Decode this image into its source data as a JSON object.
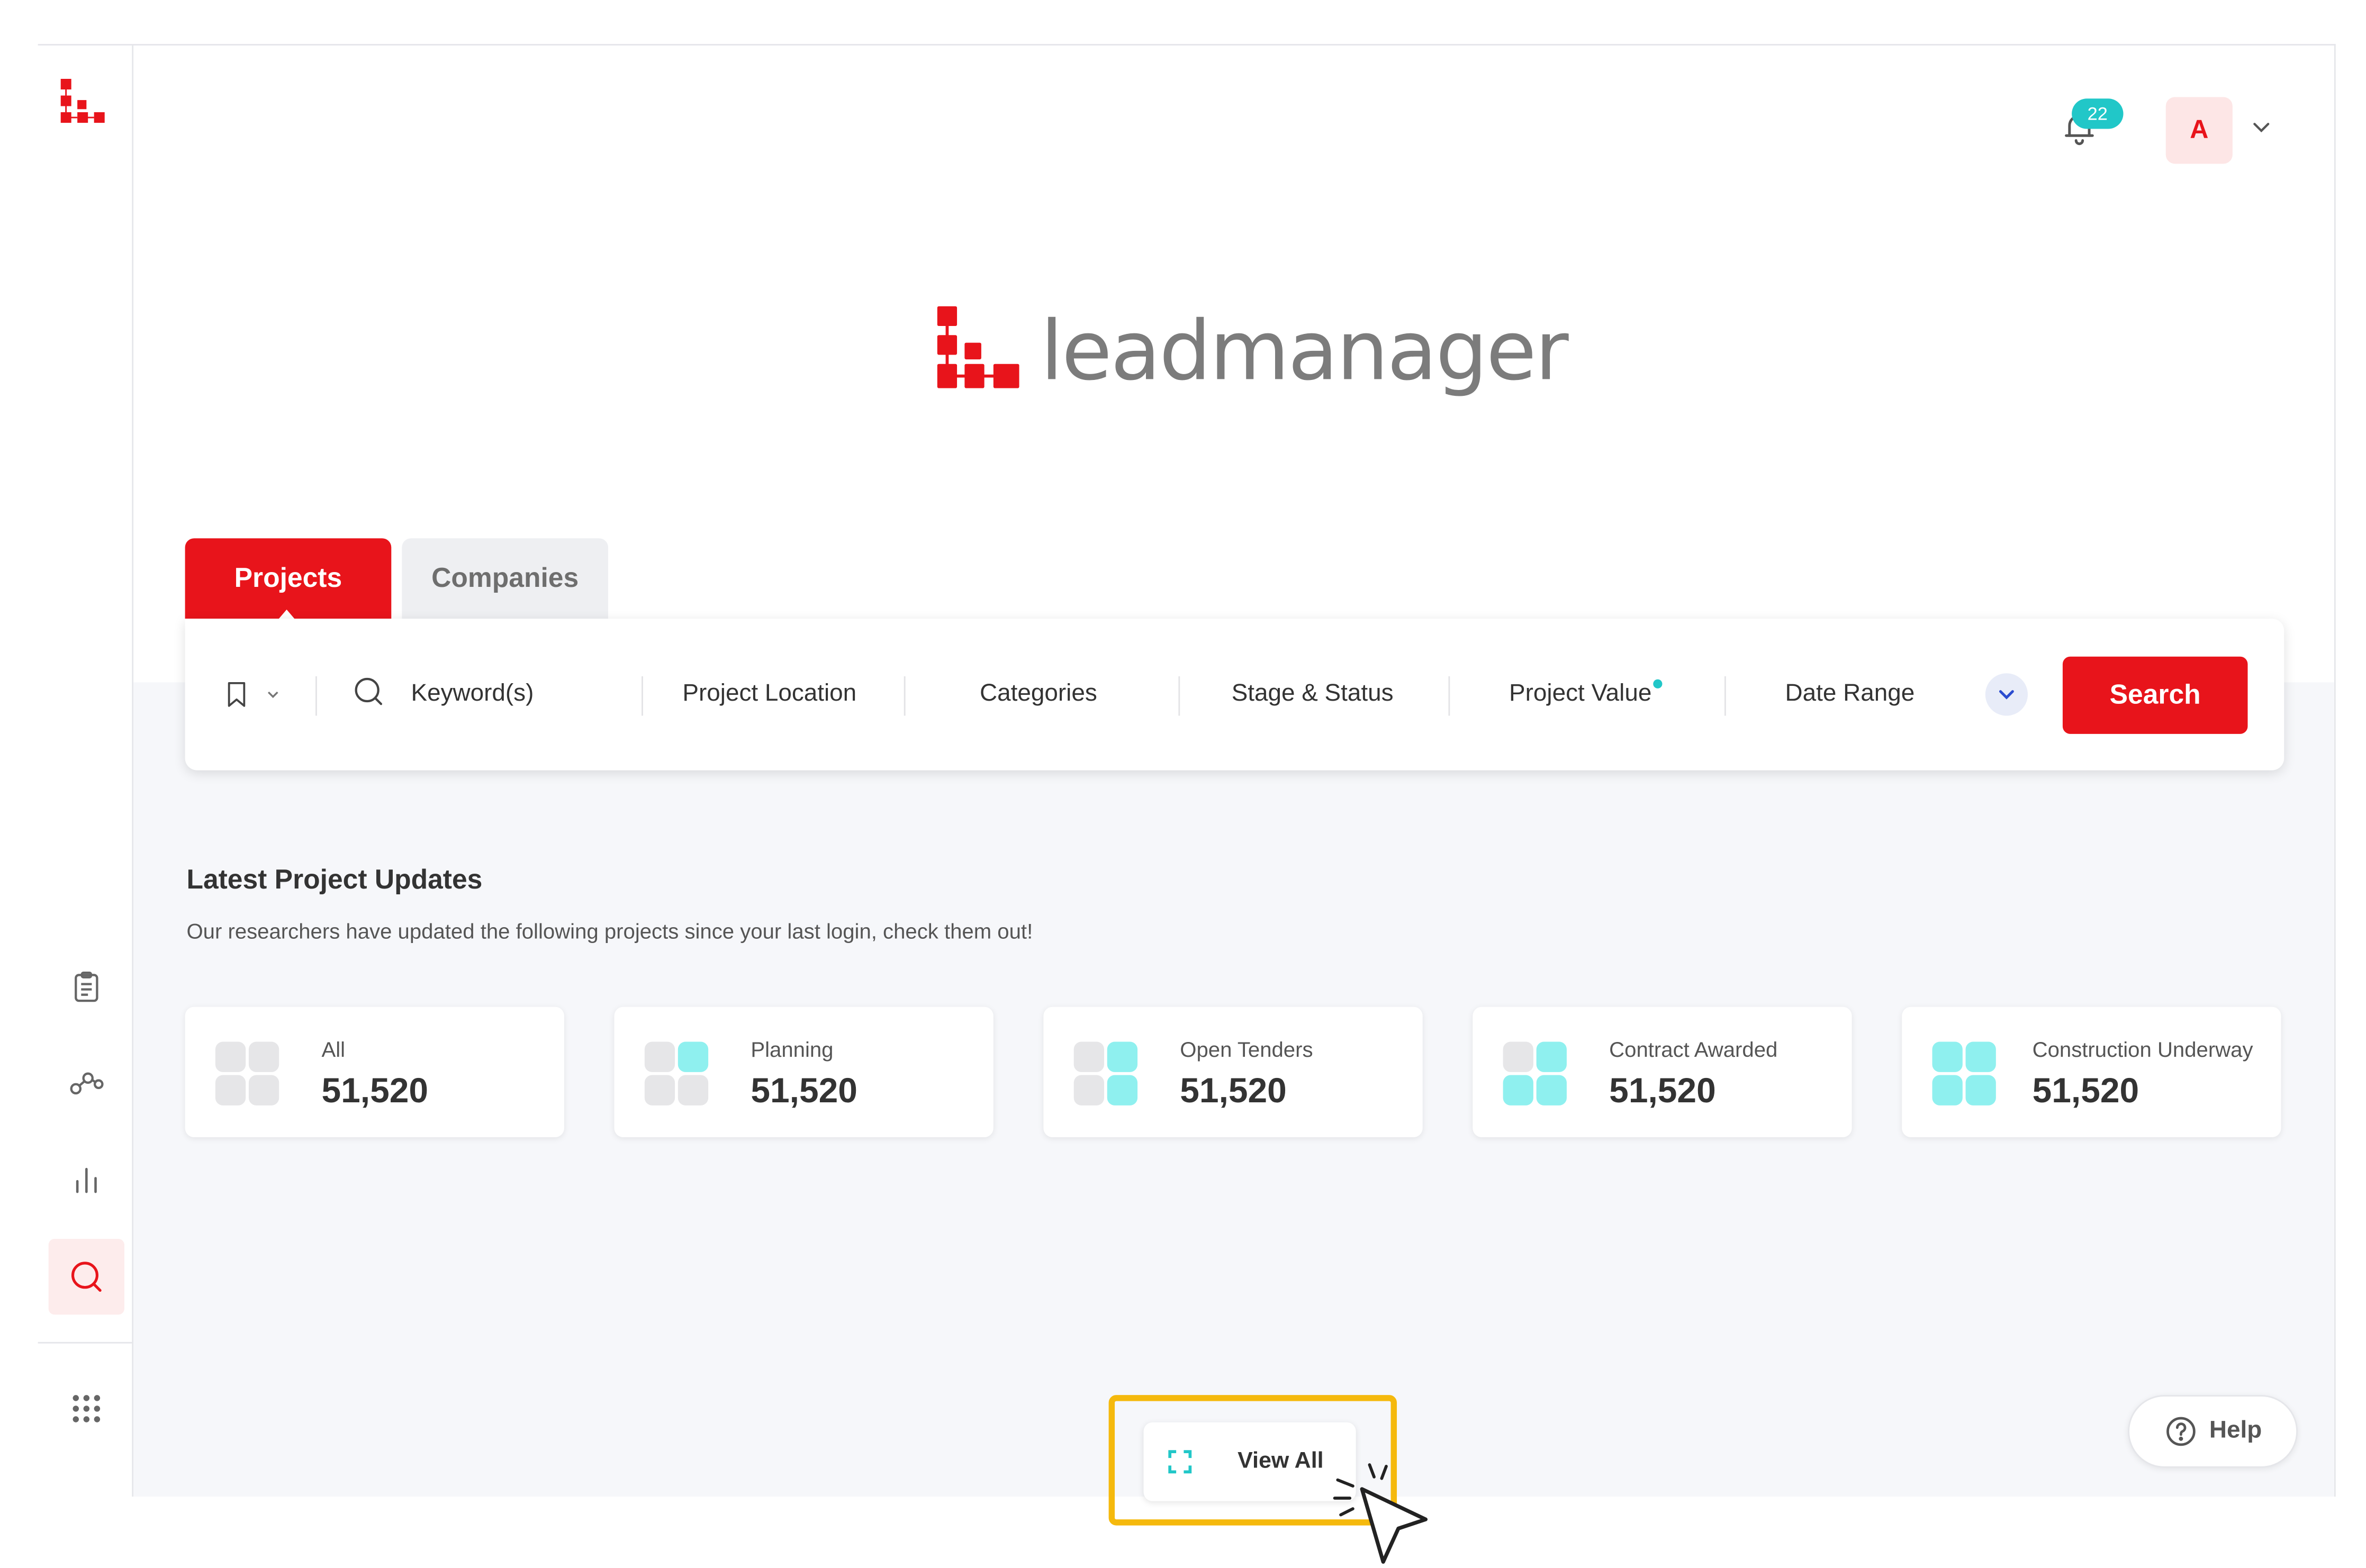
{
  "brand": {
    "name": "leadmanager",
    "accent": "#e8141b",
    "teal": "#21c7c8"
  },
  "sidebar": {
    "items": [
      {
        "name": "clipboard-icon"
      },
      {
        "name": "connections-icon"
      },
      {
        "name": "bar-chart-icon"
      },
      {
        "name": "search-icon",
        "active": true
      },
      {
        "name": "apps-grid-icon"
      }
    ]
  },
  "topbar": {
    "notification_count": "22",
    "avatar_initial": "A"
  },
  "tabs": [
    {
      "label": "Projects",
      "active": true
    },
    {
      "label": "Companies",
      "active": false
    }
  ],
  "search": {
    "keyword_placeholder": "Keyword(s)",
    "filters": [
      "Project Location",
      "Categories",
      "Stage & Status",
      "Project Value",
      "Date Range"
    ],
    "button_label": "Search"
  },
  "updates": {
    "title": "Latest Project Updates",
    "subtitle": "Our researchers have updated the following projects since your last login, check them out!",
    "cards": [
      {
        "label": "All",
        "value": "51,520"
      },
      {
        "label": "Planning",
        "value": "51,520"
      },
      {
        "label": "Open Tenders",
        "value": "51,520"
      },
      {
        "label": "Contract Awarded",
        "value": "51,520"
      },
      {
        "label": "Construction Underway",
        "value": "51,520"
      }
    ]
  },
  "view_all_label": "View All",
  "help_label": "Help"
}
